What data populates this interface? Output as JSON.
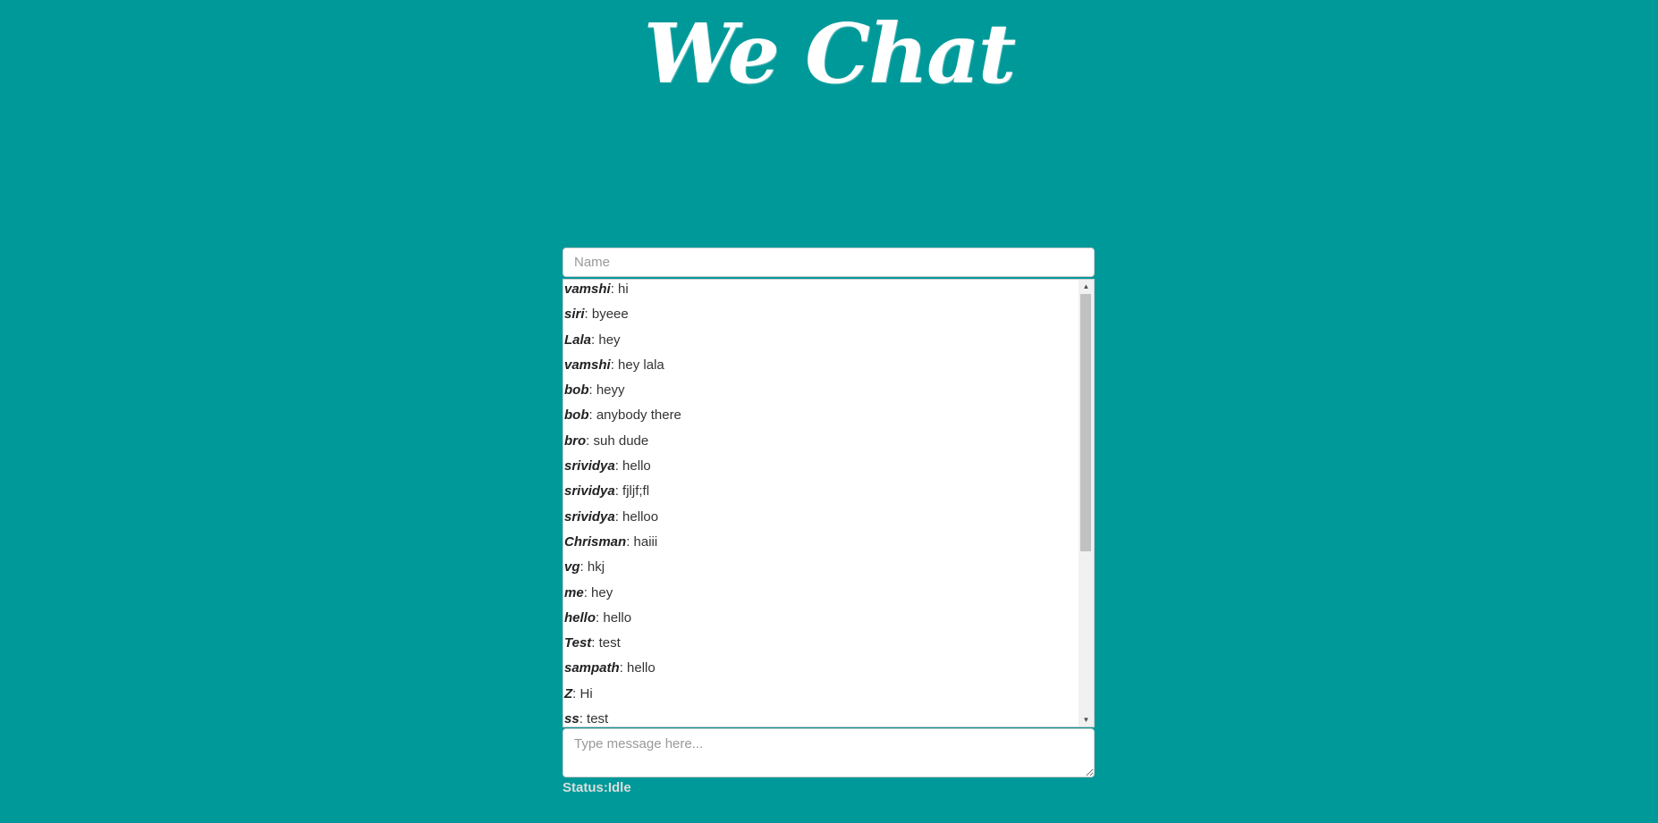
{
  "header": {
    "title": "We Chat"
  },
  "name_field": {
    "placeholder": "Name",
    "value": ""
  },
  "messages": [
    {
      "name": "vamshi",
      "text": ": hi"
    },
    {
      "name": "siri",
      "text": ": byeee"
    },
    {
      "name": "Lala",
      "text": ": hey"
    },
    {
      "name": "vamshi",
      "text": ": hey lala"
    },
    {
      "name": "bob",
      "text": ": heyy"
    },
    {
      "name": "bob",
      "text": ": anybody there"
    },
    {
      "name": "bro",
      "text": ": suh dude"
    },
    {
      "name": "srividya",
      "text": ": hello"
    },
    {
      "name": "srividya",
      "text": ": fjljf;fl"
    },
    {
      "name": "srividya",
      "text": ": helloo"
    },
    {
      "name": "Chrisman",
      "text": ": haiii"
    },
    {
      "name": "vg",
      "text": ": hkj"
    },
    {
      "name": "me",
      "text": ": hey"
    },
    {
      "name": "hello",
      "text": ": hello"
    },
    {
      "name": "Test",
      "text": ": test"
    },
    {
      "name": "sampath",
      "text": ": hello"
    },
    {
      "name": "Z",
      "text": ": Hi"
    },
    {
      "name": "ss",
      "text": ": test"
    }
  ],
  "message_field": {
    "placeholder": "Type message here...",
    "value": ""
  },
  "status": {
    "text": "Status:Idle"
  },
  "colors": {
    "background": "#009999",
    "title": "#ffffff",
    "status": "#dddddd"
  },
  "icons": {
    "scroll_up": "scroll-up-arrow-icon",
    "scroll_down": "scroll-down-arrow-icon"
  }
}
